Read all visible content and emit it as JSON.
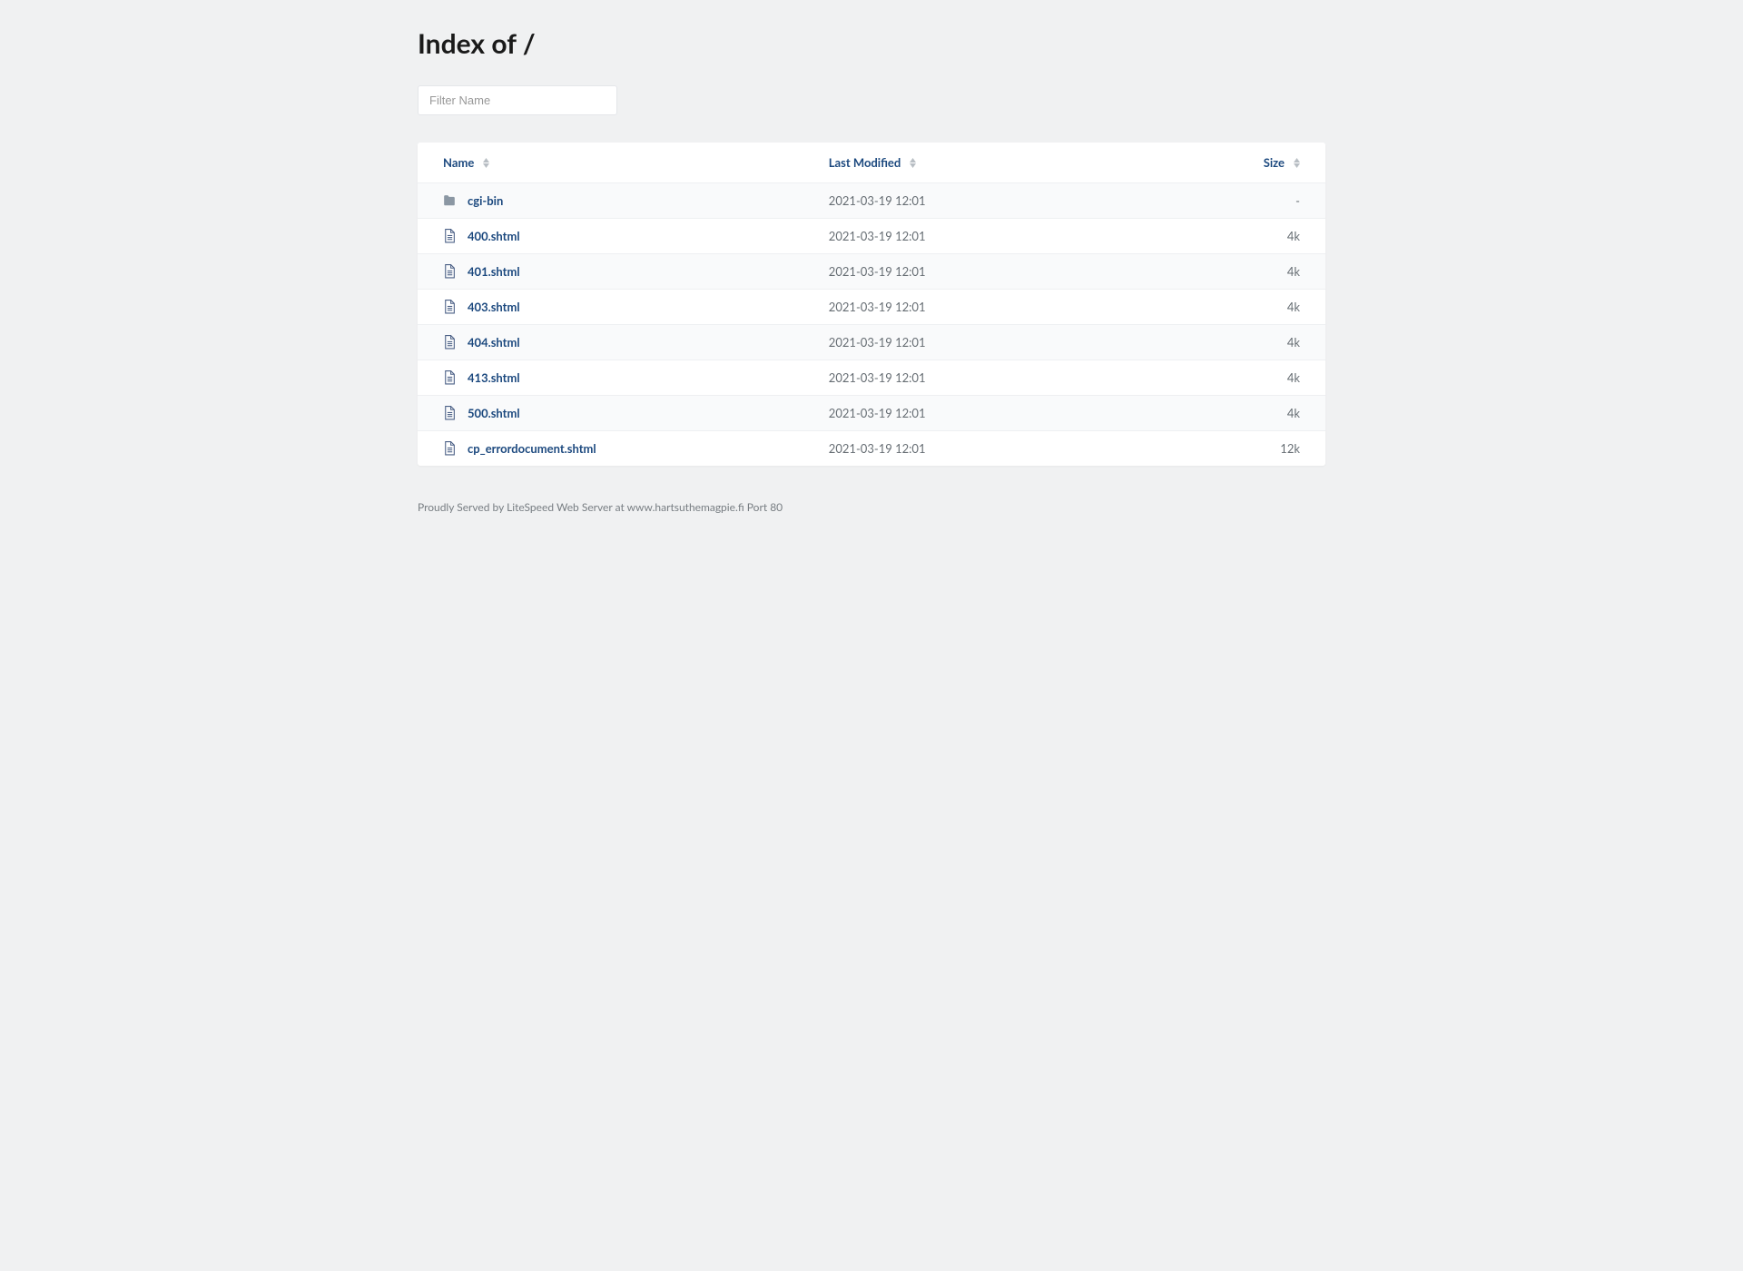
{
  "title": "Index of /",
  "filter": {
    "placeholder": "Filter Name",
    "value": ""
  },
  "columns": {
    "name": "Name",
    "modified": "Last Modified",
    "size": "Size"
  },
  "rows": [
    {
      "type": "folder",
      "name": "cgi-bin",
      "modified": "2021-03-19 12:01",
      "size": "-"
    },
    {
      "type": "file",
      "name": "400.shtml",
      "modified": "2021-03-19 12:01",
      "size": "4k"
    },
    {
      "type": "file",
      "name": "401.shtml",
      "modified": "2021-03-19 12:01",
      "size": "4k"
    },
    {
      "type": "file",
      "name": "403.shtml",
      "modified": "2021-03-19 12:01",
      "size": "4k"
    },
    {
      "type": "file",
      "name": "404.shtml",
      "modified": "2021-03-19 12:01",
      "size": "4k"
    },
    {
      "type": "file",
      "name": "413.shtml",
      "modified": "2021-03-19 12:01",
      "size": "4k"
    },
    {
      "type": "file",
      "name": "500.shtml",
      "modified": "2021-03-19 12:01",
      "size": "4k"
    },
    {
      "type": "file",
      "name": "cp_errordocument.shtml",
      "modified": "2021-03-19 12:01",
      "size": "12k"
    }
  ],
  "footer": "Proudly Served by LiteSpeed Web Server at www.hartsuthemagpie.fi Port 80",
  "icons": {
    "folder": "folder-icon",
    "file": "file-icon"
  }
}
